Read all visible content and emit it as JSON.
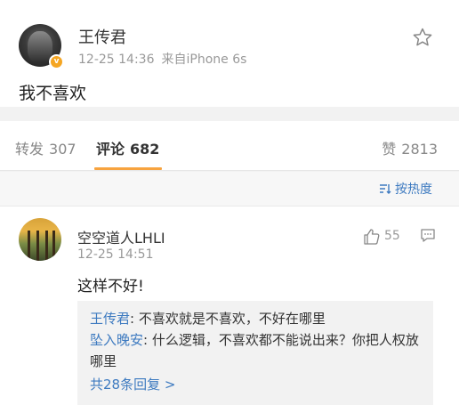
{
  "post": {
    "author": "王传君",
    "verified_badge": "v",
    "time": "12-25 14:36",
    "source": "来自iPhone 6s",
    "content": "我不喜欢"
  },
  "tabs": {
    "repost_label": "转发",
    "repost_count": "307",
    "comment_label": "评论",
    "comment_count": "682",
    "like_label": "赞",
    "like_count": "2813"
  },
  "sort": {
    "label": "按热度"
  },
  "comment": {
    "user": "空空道人LHLI",
    "time": "12-25 14:51",
    "text": "这样不好!",
    "likes": "55",
    "replies": [
      {
        "user": "王传君",
        "text": ": 不喜欢就是不喜欢，不好在哪里"
      },
      {
        "user": "坠入晚安",
        "text": ": 什么逻辑，不喜欢都不能说出来？你把人权放哪里"
      }
    ],
    "more_replies": "共28条回复 >"
  },
  "colors": {
    "accent": "#f7a33f",
    "link": "#3d7ac0",
    "badge": "#f5a623"
  }
}
